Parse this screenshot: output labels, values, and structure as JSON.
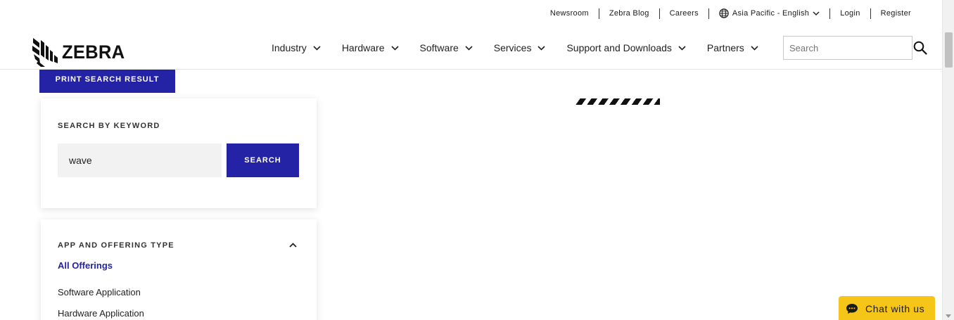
{
  "utility_nav": {
    "newsroom": "Newsroom",
    "blog": "Zebra Blog",
    "careers": "Careers",
    "region": "Asia Pacific - English",
    "login": "Login",
    "register": "Register"
  },
  "brand": {
    "logo_text": "ZEBRA",
    "logo_icon": "zebra-head-icon"
  },
  "main_nav": {
    "items": [
      {
        "label": "Industry"
      },
      {
        "label": "Hardware"
      },
      {
        "label": "Software"
      },
      {
        "label": "Services"
      },
      {
        "label": "Support and Downloads"
      },
      {
        "label": "Partners"
      }
    ]
  },
  "search": {
    "placeholder": "Search",
    "icon": "search-icon"
  },
  "print_button": {
    "label": "PRINT SEARCH RESULT"
  },
  "keyword_search": {
    "label": "SEARCH BY KEYWORD",
    "value": "wave",
    "button_label": "SEARCH"
  },
  "offering_filter": {
    "label": "APP AND OFFERING TYPE",
    "items": [
      {
        "label": "All Offerings"
      },
      {
        "label": "Software Application"
      },
      {
        "label": "Hardware Application"
      }
    ]
  },
  "chat": {
    "label": "Chat with us",
    "icon": "chat-bubble-icon"
  },
  "colors": {
    "brand_blue": "#2422a5",
    "chat_yellow": "#f5c518"
  }
}
